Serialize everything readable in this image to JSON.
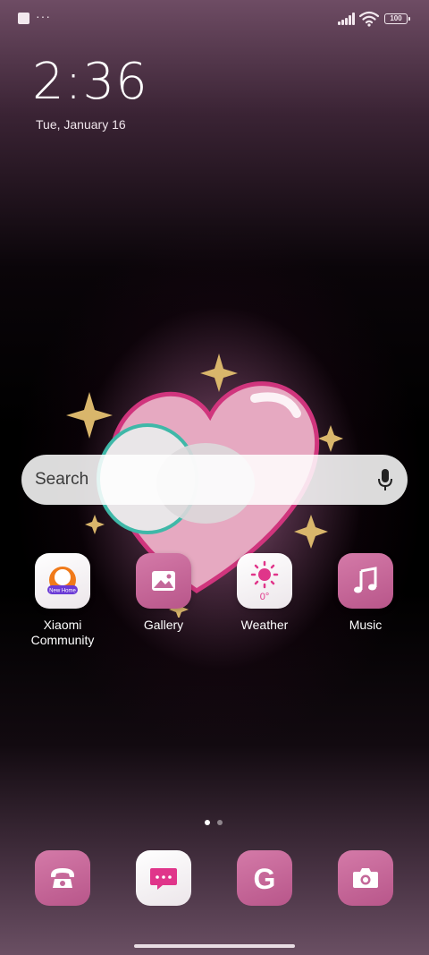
{
  "status_bar": {
    "notification_more": "···",
    "battery": "100"
  },
  "lockscreen": {
    "time": "2:36",
    "date": "Tue, January 16"
  },
  "search": {
    "placeholder": "Search"
  },
  "apps": [
    {
      "label": "Xiaomi\nCommunity",
      "icon": "xiaomi-community-icon",
      "sticker_text": "New Home"
    },
    {
      "label": "Gallery",
      "icon": "gallery-icon"
    },
    {
      "label": "Weather",
      "icon": "weather-icon",
      "temp": "0°"
    },
    {
      "label": "Music",
      "icon": "music-icon"
    }
  ],
  "page_indicator": {
    "pages": 2,
    "active": 1
  },
  "dock": [
    {
      "icon": "phone-icon"
    },
    {
      "icon": "messages-icon"
    },
    {
      "icon": "google-icon",
      "glyph": "G"
    },
    {
      "icon": "camera-icon"
    }
  ],
  "colors": {
    "accent_pink": "#c4689a",
    "light_tile": "#f5f0f3",
    "icon_pink": "#e0358a"
  }
}
